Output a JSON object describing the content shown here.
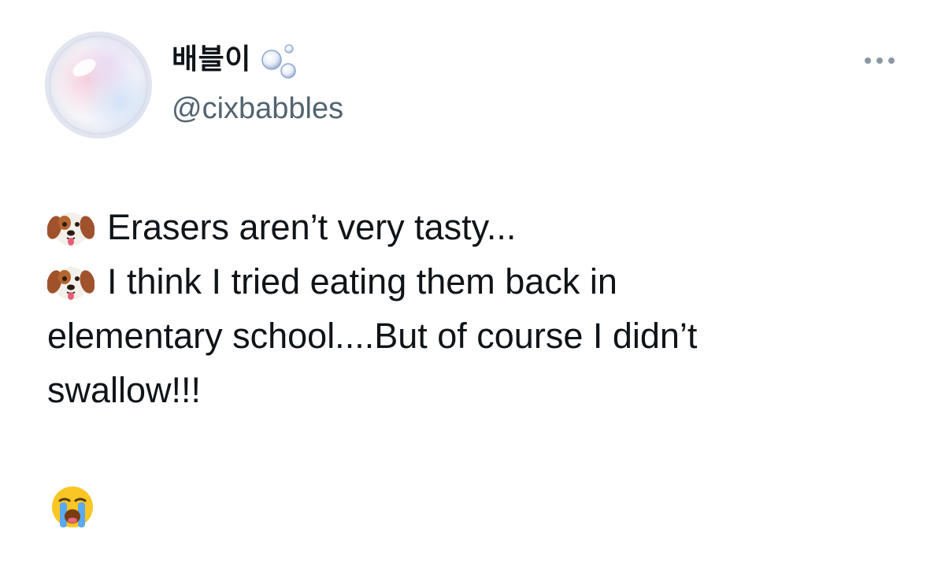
{
  "author": {
    "display_name": "배블이",
    "handle": "@cixbabbles",
    "avatar_icon": "soap-bubble-avatar",
    "name_icon": "bubbles-icon"
  },
  "menu": {
    "icon": "more-options-icon"
  },
  "tweet": {
    "lines": [
      {
        "emoji": "dog-face-emoji",
        "text": "Erasers aren’t very tasty..."
      },
      {
        "emoji": "dog-face-emoji",
        "text": "I think I tried eating them back in"
      },
      {
        "emoji": "",
        "text": "elementary school....But of course I didn’t"
      },
      {
        "emoji": "",
        "text": "swallow!!!"
      }
    ],
    "trailing_emoji": "loudly-crying-face-emoji"
  },
  "colors": {
    "text": "#0f1419",
    "secondary": "#536471",
    "background": "#ffffff"
  }
}
